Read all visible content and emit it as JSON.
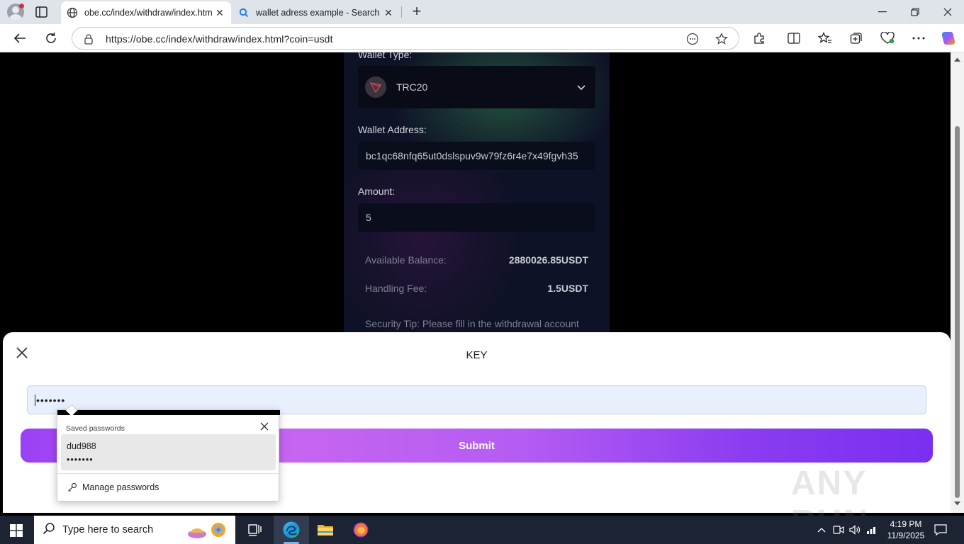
{
  "browser": {
    "tabs": [
      {
        "title": "obe.cc/index/withdraw/index.htm",
        "active": true
      },
      {
        "title": "wallet adress example - Search",
        "active": false
      }
    ],
    "url": "https://obe.cc/index/withdraw/index.html?coin=usdt"
  },
  "page": {
    "wallet_type_label": "Wallet Type:",
    "wallet_type_value": "TRC20",
    "wallet_address_label": "Wallet Address:",
    "wallet_address_value": "bc1qc68nfq65ut0dslspuv9w79fz6r4e7x49fgvh35",
    "amount_label": "Amount:",
    "amount_value": "5",
    "available_balance_label": "Available Balance:",
    "available_balance_value": "2880026.85USDT",
    "handling_fee_label": "Handling Fee:",
    "handling_fee_value": "1.5USDT",
    "security_tip": "Security Tip: Please fill in the withdrawal account"
  },
  "modal": {
    "title": "KEY",
    "key_value": "•••••••",
    "submit_label": "Submit"
  },
  "password_popup": {
    "heading": "Saved passwords",
    "username": "dud988",
    "password_mask": "•••••••",
    "manage_label": "Manage passwords"
  },
  "watermark": "ANY RUN",
  "taskbar": {
    "search_placeholder": "Type here to search",
    "time": "4:19 PM",
    "date": "11/9/2025"
  },
  "colors": {
    "accent_purple": "#9a41f5",
    "page_background": "#000000",
    "card_background": "#0e1226",
    "key_input_background": "#e8f0fe"
  }
}
